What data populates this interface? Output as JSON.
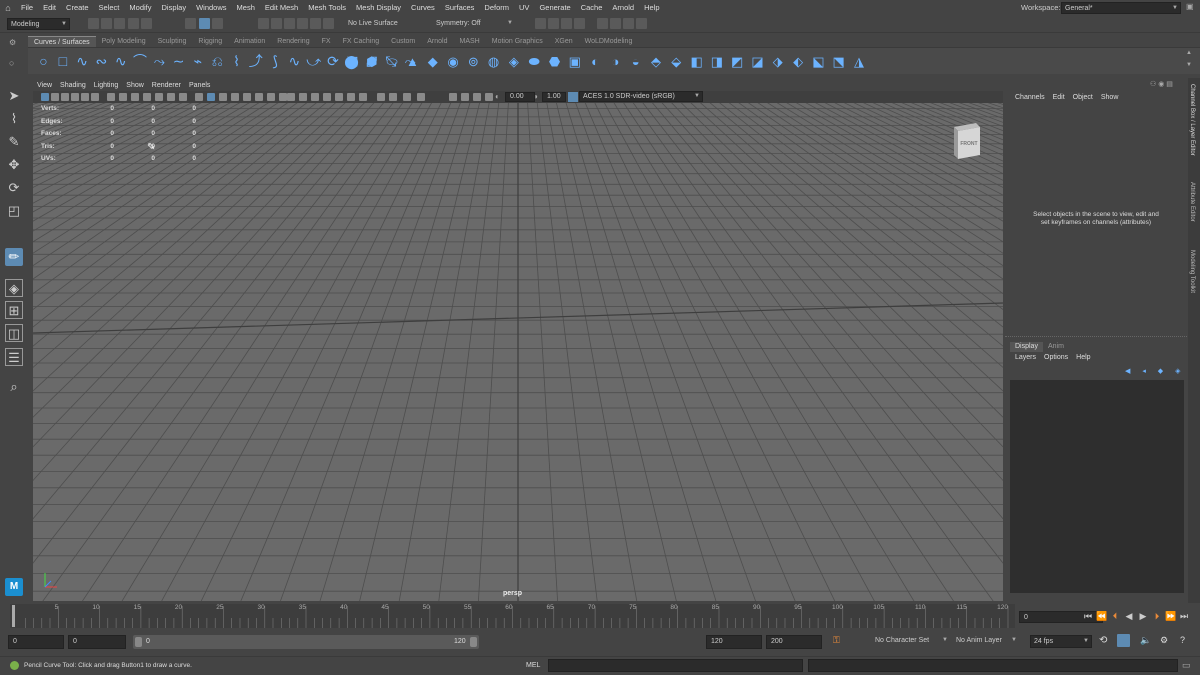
{
  "menubar": {
    "items": [
      "File",
      "Edit",
      "Create",
      "Select",
      "Modify",
      "Display",
      "Windows",
      "Mesh",
      "Edit Mesh",
      "Mesh Tools",
      "Mesh Display",
      "Curves",
      "Surfaces",
      "Deform",
      "UV",
      "Generate",
      "Cache",
      "Arnold",
      "Help"
    ],
    "workspace_label": "Workspace:",
    "workspace_value": "General*"
  },
  "statusline": {
    "menuset": "Modeling",
    "live_surface": "No Live Surface",
    "symmetry": "Symmetry: Off"
  },
  "shelf": {
    "tabs": [
      "Curves / Surfaces",
      "Poly Modeling",
      "Sculpting",
      "Rigging",
      "Animation",
      "Rendering",
      "FX",
      "FX Caching",
      "Custom",
      "Arnold",
      "MASH",
      "Motion Graphics",
      "XGen",
      "WoLDModeling"
    ],
    "active_tab": 0
  },
  "panel": {
    "menus": [
      "View",
      "Shading",
      "Lighting",
      "Show",
      "Renderer",
      "Panels"
    ],
    "exposure": "0.00",
    "gamma": "1.00",
    "color_space": "ACES 1.0 SDR-video (sRGB)"
  },
  "hud": {
    "rows": [
      {
        "label": "Verts:",
        "v1": "0",
        "v2": "0",
        "v3": "0"
      },
      {
        "label": "Edges:",
        "v1": "0",
        "v2": "0",
        "v3": "0"
      },
      {
        "label": "Faces:",
        "v1": "0",
        "v2": "0",
        "v3": "0"
      },
      {
        "label": "Tris:",
        "v1": "0",
        "v2": "0",
        "v3": "0"
      },
      {
        "label": "UVs:",
        "v1": "0",
        "v2": "0",
        "v3": "0"
      }
    ],
    "camera_name": "persp",
    "viewcube_label": "FRONT"
  },
  "channelbox": {
    "menus": [
      "Channels",
      "Edit",
      "Object",
      "Show"
    ],
    "empty_message_line1": "Select objects in the scene to view, edit and",
    "empty_message_line2": "set keyframes on channels (attributes)",
    "side_tabs": [
      "Channel Box / Layer Editor",
      "Attribute Editor",
      "Modeling Toolkit"
    ]
  },
  "layereditor": {
    "tabs": [
      "Display",
      "Anim"
    ],
    "menus": [
      "Layers",
      "Options",
      "Help"
    ]
  },
  "timeline": {
    "ticks": [
      5,
      10,
      15,
      20,
      25,
      30,
      35,
      40,
      45,
      50,
      55,
      60,
      65,
      70,
      75,
      80,
      85,
      90,
      95,
      100,
      105,
      110,
      115,
      120
    ],
    "current_frame": "0"
  },
  "range": {
    "anim_start": "0",
    "play_start": "0",
    "slider_start": "0",
    "slider_end": "120",
    "play_end": "120",
    "anim_end": "200",
    "character_set": "No Character Set",
    "anim_layer": "No Anim Layer",
    "fps": "24 fps"
  },
  "helpline": {
    "message": "Pencil Curve Tool: Click and drag Button1 to draw a curve.",
    "script_lang": "MEL"
  },
  "colors": {
    "accent": "#5d8bb3",
    "shelf_icon": "#6cb3ff",
    "viewport_bg": "#6a6a6a",
    "grid": "#4e4e4e"
  }
}
